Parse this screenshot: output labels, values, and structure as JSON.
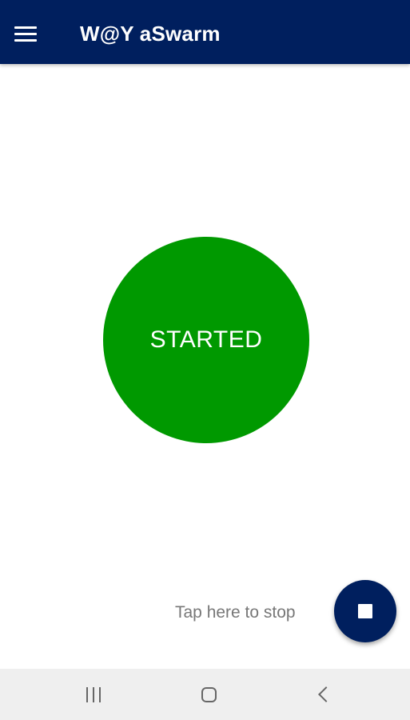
{
  "app_bar": {
    "title": "W@Y aSwarm",
    "menu_icon": "hamburger-menu-icon",
    "background_color": "#001f5e"
  },
  "main": {
    "status_text": "STARTED",
    "status_color": "#009900",
    "hint_text": "Tap here to stop"
  },
  "fab": {
    "icon": "stop-icon",
    "background_color": "#001f5e"
  },
  "nav_bar": {
    "recents_icon": "recents-icon",
    "home_icon": "home-icon",
    "back_icon": "back-icon"
  }
}
